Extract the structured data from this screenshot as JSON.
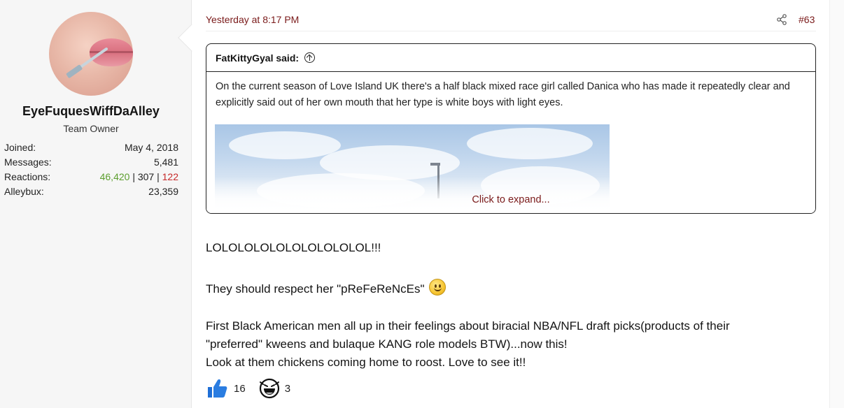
{
  "user": {
    "name": "EyeFuquesWiffDaAlley",
    "title": "Team Owner",
    "stats": [
      {
        "label": "Joined:",
        "value": "May 4, 2018"
      },
      {
        "label": "Messages:",
        "value": "5,481"
      },
      {
        "label": "Alleybux:",
        "value": "23,359"
      }
    ],
    "reactions_label": "Reactions:",
    "reactions": {
      "positive": "46,420",
      "neutral": "307",
      "negative": "122",
      "separator": " | "
    }
  },
  "post": {
    "date": "Yesterday at 8:17 PM",
    "number": "#63",
    "quote": {
      "author": "FatKittyGyal said:",
      "text": "On the current season of Love Island UK there's a half black mixed race girl called Danica who has made it repeatedly clear and explicitly said out of her own mouth that her type is white boys with light eyes.",
      "expand_label": "Click to expand..."
    },
    "body": {
      "line1": "LOLOLOLOLOLOLOLOLOLOL!!!",
      "line2": "They should respect her \"pReFeReNcEs\"",
      "line3": "First Black American men all up in their feelings about biracial NBA/NFL draft picks(products of their",
      "line4": "\"preferred\" kweens and bulaque KANG role models BTW)...now this!",
      "line5": "Look at them chickens coming home to roost. Love to see it!!"
    },
    "reactions": [
      {
        "icon": "thumbs-up-icon",
        "count": "16"
      },
      {
        "icon": "laughing-face-icon",
        "count": "3"
      }
    ]
  },
  "colors": {
    "link": "#7a1a1a",
    "positive": "#5c9e2e",
    "negative": "#c62828",
    "like_blue": "#1f6fd6"
  }
}
